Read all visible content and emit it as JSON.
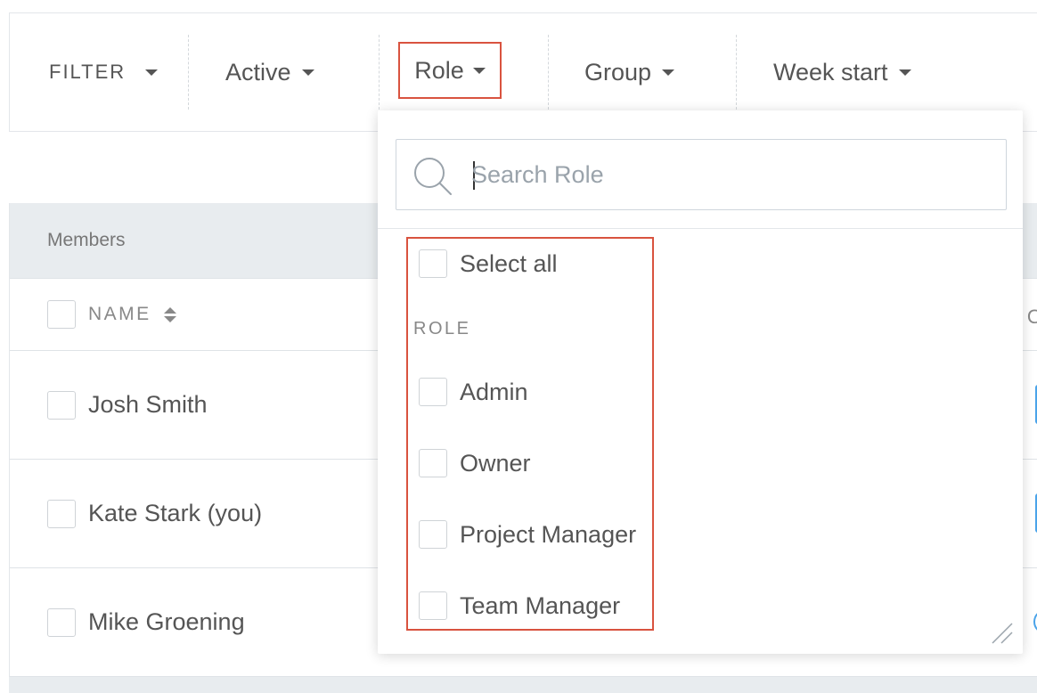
{
  "filter_bar": {
    "label": "FILTER",
    "items": [
      {
        "label": "Active"
      },
      {
        "label": "Role"
      },
      {
        "label": "Group"
      },
      {
        "label": "Week start"
      }
    ]
  },
  "table": {
    "section_title": "Members",
    "columns": [
      {
        "label": "NAME"
      }
    ],
    "right_edge_partial": "O",
    "rows": [
      {
        "name": "Josh Smith"
      },
      {
        "name": "Kate Stark (you)"
      },
      {
        "name": "Mike Groening"
      }
    ]
  },
  "role_dropdown": {
    "search_placeholder": "Search Role",
    "select_all_label": "Select all",
    "group_title": "ROLE",
    "options": [
      {
        "label": "Admin",
        "checked": false
      },
      {
        "label": "Owner",
        "checked": false
      },
      {
        "label": "Project Manager",
        "checked": false
      },
      {
        "label": "Team Manager",
        "checked": false
      }
    ]
  },
  "colors": {
    "highlight": "#d9533f",
    "accent": "#4aa3e9",
    "header_bg": "#e8ecef"
  }
}
